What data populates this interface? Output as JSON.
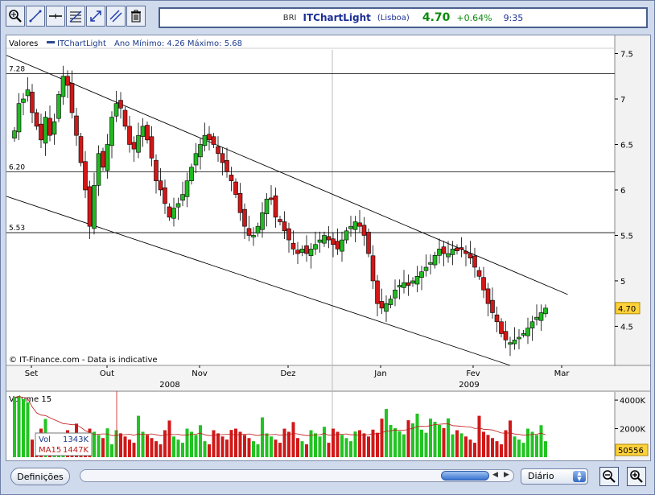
{
  "quote": {
    "symbol": "BRI",
    "name": "ITChartLight",
    "exchange": "(Lisboa)",
    "price": "4.70",
    "change": "+0.64%",
    "time": "9:35"
  },
  "toolbar": {
    "tools": [
      "zoom-tool-icon",
      "line-tool-icon",
      "horizontal-line-tool-icon",
      "fibonacci-tool-icon",
      "expand-tool-icon",
      "channel-tool-icon",
      "trash-icon"
    ]
  },
  "bottom": {
    "settings_label": "Definições",
    "period_value": "Diário"
  },
  "chart_data": {
    "type": "candlestick",
    "legend_label": "Valores",
    "series_name": "ITChartLight",
    "range_info": "Ano Mínimo: 4.26 Máximo: 5.68",
    "watermark": "© IT-Finance.com - Data is indicative",
    "last_price_label": "4.70",
    "y_ticks": [
      4.5,
      5,
      5.5,
      6,
      6.5,
      7,
      7.5
    ],
    "y_tick_labels": [
      "4.5",
      "5",
      "5.5",
      "6",
      "6.5",
      "7",
      "7.5"
    ],
    "ylim": [
      4.07,
      7.54
    ],
    "x_labels": [
      "Set",
      "Out",
      "Nov",
      "Dez",
      "Jan",
      "Fev",
      "Mar"
    ],
    "year_labels": [
      "2008",
      "2009"
    ],
    "h_lines": [
      {
        "value": 7.28,
        "label": "7.28"
      },
      {
        "value": 6.2,
        "label": "6.20"
      },
      {
        "value": 5.53,
        "label": "5.53"
      }
    ],
    "trend_lines": [
      {
        "from": [
          0,
          7.48
        ],
        "to": [
          125,
          4.85
        ]
      },
      {
        "from": [
          0,
          5.93
        ],
        "to": [
          112,
          4.07
        ]
      }
    ],
    "x_count": 125,
    "closes": [
      6.65,
      6.95,
      7.0,
      7.1,
      6.85,
      6.7,
      6.55,
      6.8,
      6.6,
      6.75,
      7.05,
      7.25,
      7.15,
      6.85,
      6.6,
      6.3,
      6.0,
      5.6,
      6.05,
      6.4,
      6.25,
      6.5,
      6.8,
      6.95,
      6.9,
      6.7,
      6.5,
      6.45,
      6.6,
      6.7,
      6.55,
      6.35,
      6.1,
      6.0,
      5.85,
      5.7,
      5.8,
      5.85,
      5.95,
      6.1,
      6.25,
      6.4,
      6.5,
      6.6,
      6.55,
      6.5,
      6.4,
      6.3,
      6.2,
      6.1,
      5.95,
      5.75,
      5.6,
      5.5,
      5.5,
      5.6,
      5.75,
      5.9,
      5.9,
      5.7,
      5.65,
      5.55,
      5.45,
      5.35,
      5.3,
      5.35,
      5.3,
      5.35,
      5.4,
      5.45,
      5.5,
      5.45,
      5.4,
      5.35,
      5.45,
      5.55,
      5.6,
      5.65,
      5.6,
      5.5,
      5.3,
      5.0,
      4.75,
      4.7,
      4.75,
      4.8,
      4.9,
      4.95,
      4.98,
      4.95,
      5.0,
      5.05,
      5.1,
      5.15,
      5.2,
      5.28,
      5.35,
      5.3,
      5.3,
      5.35,
      5.33,
      5.35,
      5.3,
      5.25,
      5.15,
      5.05,
      4.9,
      4.75,
      4.65,
      4.55,
      4.42,
      4.35,
      4.32,
      4.35,
      4.38,
      4.42,
      4.48,
      4.55,
      4.6,
      4.65,
      4.7
    ]
  },
  "volume_data": {
    "title": "Volume 15",
    "y_ticks": [
      2000,
      4000
    ],
    "y_tick_labels": [
      "2000K",
      "4000K"
    ],
    "ymax": 4400,
    "last_label": "50556",
    "tooltip": {
      "vol_label": "Vol",
      "vol_value": "1343K",
      "ma_label": "MA15",
      "ma_value": "1447K"
    }
  }
}
